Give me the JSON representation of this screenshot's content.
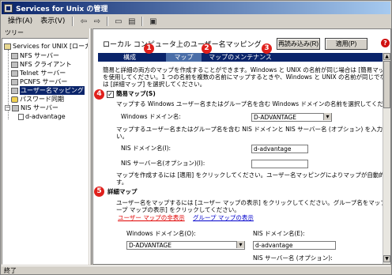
{
  "window": {
    "title": "Services for Unix の管理"
  },
  "menu": {
    "items": [
      "操作(A)",
      "表示(V)"
    ]
  },
  "left_tab": "ツリー",
  "tree": {
    "root": "Services for UNIX [ローカル]",
    "items": [
      "NFS サーバー",
      "NFS クライアント",
      "Telnet サーバー",
      "PCNFS サーバー",
      "ユーザー名マッピング",
      "パスワード同期",
      "NIS サーバー"
    ],
    "sub_item": "d-advantage"
  },
  "header": {
    "title": "ローカル コンピュータ上のユーザー名マッピング",
    "reload_button": "再読み込み(R)",
    "apply_button": "適用(P)",
    "help_glyph": "?"
  },
  "tabs": [
    "構成",
    "マップ",
    "マップのメンテナンス"
  ],
  "callouts": [
    "1",
    "2",
    "3",
    "4",
    "5"
  ],
  "content": {
    "intro_1": "簡易と詳細の両方のマップを作成することができます。Windows と UNIX の名前が同じ場合は [簡易マップ]",
    "intro_2": "を使用してください。1 つの名前を複数の名前にマップするときや、Windows と UNIX の名前が同じでない場合",
    "intro_3": "は [詳細マップ] を選択してください。",
    "simple_map_label": "簡易マップ(S)",
    "simple_map_checked": true,
    "simple_desc": "マップする Windows ユーザー名またはグループ名を含む Windows ドメインの名前を選択してください。",
    "windows_domain_label": "Windows ドメイン名:",
    "windows_domain_value": "D-ADVANTAGE",
    "nis_desc": "マップするユーザー名またはグループ名を含む NIS ドメインと NIS サーバー名 (オプション) を入力してくださ",
    "nis_desc_2": "い。",
    "nis_domain_label": "NIS ドメイン名(I):",
    "nis_domain_value": "d-advantage",
    "nis_server_label": "NIS サーバー名(オプション)(I):",
    "nis_server_value": "",
    "apply_note_1": "マップを作成するには [適用] をクリックしてください。ユーザー名マッピングによりマップが自動的に作成されま",
    "apply_note_2": "す。",
    "advanced_map_label": "詳細マップ",
    "advanced_desc_1": "ユーザー名をマップするには [ユーザー マップの表示] をクリックしてください。グループ名をマップするには [グル",
    "advanced_desc_2": "ープ マップの表示] をクリックしてください。",
    "user_map_link": "ユーザー マップの非表示",
    "group_map_link": "グループ マップの表示",
    "adv_windows_domain_label": "Windows ドメイン名(O):",
    "adv_windows_domain_value": "D-ADVANTAGE",
    "adv_nis_domain_label": "NIS ドメイン名(E):",
    "adv_nis_domain_value": "d-advantage",
    "adv_nis_server_label": "NIS サーバー名 (オプション):"
  },
  "status": {
    "text": "終了"
  }
}
